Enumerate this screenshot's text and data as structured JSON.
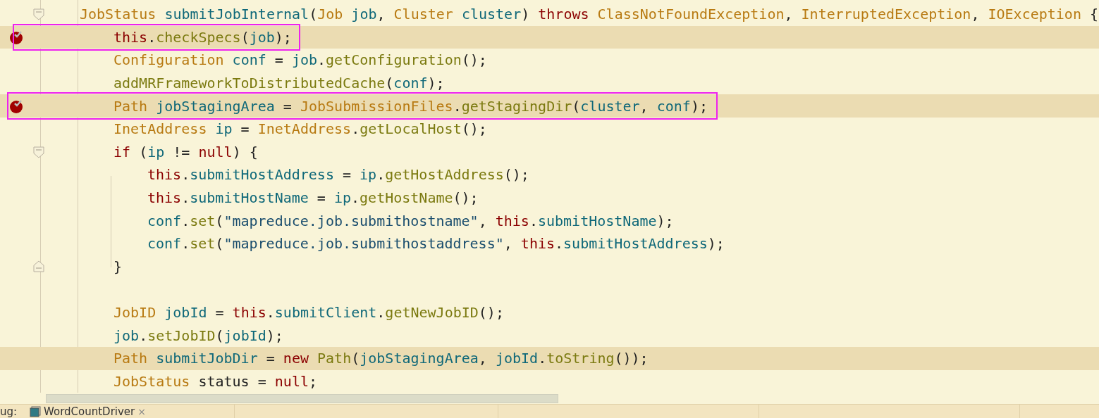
{
  "lines": [
    {
      "kind": "code",
      "fold_open": true,
      "fold_close": false,
      "breakpoint": false,
      "highlighted": false,
      "annotated": false,
      "tokens": [
        {
          "text": "JobStatus",
          "kind": "type"
        },
        {
          "text": " submitJobInternal",
          "kind": "field"
        },
        {
          "text": "(",
          "kind": "plain"
        },
        {
          "text": "Job",
          "kind": "type"
        },
        {
          "text": " job",
          "kind": "field"
        },
        {
          "text": ", ",
          "kind": "plain"
        },
        {
          "text": "Cluster",
          "kind": "type"
        },
        {
          "text": " cluster",
          "kind": "field"
        },
        {
          "text": ") ",
          "kind": "plain"
        },
        {
          "text": "throws",
          "kind": "keyword"
        },
        {
          "text": " ClassNotFoundException",
          "kind": "type"
        },
        {
          "text": ", ",
          "kind": "plain"
        },
        {
          "text": "InterruptedException",
          "kind": "type"
        },
        {
          "text": ", ",
          "kind": "plain"
        },
        {
          "text": "IOException",
          "kind": "type"
        },
        {
          "text": " {",
          "kind": "plain"
        }
      ],
      "children": [
        {
          "kind": "code",
          "fold_open": false,
          "fold_close": false,
          "breakpoint": true,
          "highlighted": true,
          "annotated": true,
          "tokens": [
            {
              "text": "this",
              "kind": "keyword"
            },
            {
              "text": ".",
              "kind": "plain"
            },
            {
              "text": "checkSpecs",
              "kind": "method"
            },
            {
              "text": "(",
              "kind": "plain"
            },
            {
              "text": "job",
              "kind": "field"
            },
            {
              "text": ");",
              "kind": "plain"
            }
          ]
        },
        {
          "kind": "code",
          "fold_open": false,
          "fold_close": false,
          "breakpoint": false,
          "highlighted": false,
          "annotated": false,
          "tokens": [
            {
              "text": "Configuration",
              "kind": "type"
            },
            {
              "text": " conf",
              "kind": "field"
            },
            {
              "text": " = ",
              "kind": "plain"
            },
            {
              "text": "job",
              "kind": "field"
            },
            {
              "text": ".",
              "kind": "plain"
            },
            {
              "text": "getConfiguration",
              "kind": "method"
            },
            {
              "text": "();",
              "kind": "plain"
            }
          ]
        },
        {
          "kind": "code",
          "fold_open": false,
          "fold_close": false,
          "breakpoint": false,
          "highlighted": false,
          "annotated": false,
          "tokens": [
            {
              "text": "addMRFrameworkToDistributedCache",
              "kind": "method"
            },
            {
              "text": "(",
              "kind": "plain"
            },
            {
              "text": "conf",
              "kind": "field"
            },
            {
              "text": ");",
              "kind": "plain"
            }
          ]
        },
        {
          "kind": "code",
          "fold_open": false,
          "fold_close": false,
          "breakpoint": true,
          "highlighted": true,
          "annotated": true,
          "tokens": [
            {
              "text": "Path",
              "kind": "type"
            },
            {
              "text": " jobStagingArea",
              "kind": "field"
            },
            {
              "text": " = ",
              "kind": "plain"
            },
            {
              "text": "JobSubmissionFiles",
              "kind": "type"
            },
            {
              "text": ".",
              "kind": "plain"
            },
            {
              "text": "getStagingDir",
              "kind": "method"
            },
            {
              "text": "(",
              "kind": "plain"
            },
            {
              "text": "cluster",
              "kind": "field"
            },
            {
              "text": ", ",
              "kind": "plain"
            },
            {
              "text": "conf",
              "kind": "field"
            },
            {
              "text": ");",
              "kind": "plain"
            }
          ]
        },
        {
          "kind": "code",
          "fold_open": false,
          "fold_close": false,
          "breakpoint": false,
          "highlighted": false,
          "annotated": false,
          "tokens": [
            {
              "text": "InetAddress",
              "kind": "type"
            },
            {
              "text": " ip",
              "kind": "field"
            },
            {
              "text": " = ",
              "kind": "plain"
            },
            {
              "text": "InetAddress",
              "kind": "type"
            },
            {
              "text": ".",
              "kind": "plain"
            },
            {
              "text": "getLocalHost",
              "kind": "method"
            },
            {
              "text": "();",
              "kind": "plain"
            }
          ]
        },
        {
          "kind": "code",
          "fold_open": true,
          "fold_close": false,
          "breakpoint": false,
          "highlighted": false,
          "annotated": false,
          "tokens": [
            {
              "text": "if",
              "kind": "keyword"
            },
            {
              "text": " (",
              "kind": "plain"
            },
            {
              "text": "ip",
              "kind": "field"
            },
            {
              "text": " != ",
              "kind": "plain"
            },
            {
              "text": "null",
              "kind": "keyword"
            },
            {
              "text": ") {",
              "kind": "plain"
            }
          ],
          "children": [
            {
              "kind": "code",
              "fold_open": false,
              "fold_close": false,
              "breakpoint": false,
              "highlighted": false,
              "annotated": false,
              "tokens": [
                {
                  "text": "this",
                  "kind": "keyword"
                },
                {
                  "text": ".",
                  "kind": "plain"
                },
                {
                  "text": "submitHostAddress",
                  "kind": "field"
                },
                {
                  "text": " = ",
                  "kind": "plain"
                },
                {
                  "text": "ip",
                  "kind": "field"
                },
                {
                  "text": ".",
                  "kind": "plain"
                },
                {
                  "text": "getHostAddress",
                  "kind": "method"
                },
                {
                  "text": "();",
                  "kind": "plain"
                }
              ]
            },
            {
              "kind": "code",
              "fold_open": false,
              "fold_close": false,
              "breakpoint": false,
              "highlighted": false,
              "annotated": false,
              "tokens": [
                {
                  "text": "this",
                  "kind": "keyword"
                },
                {
                  "text": ".",
                  "kind": "plain"
                },
                {
                  "text": "submitHostName",
                  "kind": "field"
                },
                {
                  "text": " = ",
                  "kind": "plain"
                },
                {
                  "text": "ip",
                  "kind": "field"
                },
                {
                  "text": ".",
                  "kind": "plain"
                },
                {
                  "text": "getHostName",
                  "kind": "method"
                },
                {
                  "text": "();",
                  "kind": "plain"
                }
              ]
            },
            {
              "kind": "code",
              "fold_open": false,
              "fold_close": false,
              "breakpoint": false,
              "highlighted": false,
              "annotated": false,
              "tokens": [
                {
                  "text": "conf",
                  "kind": "field"
                },
                {
                  "text": ".",
                  "kind": "plain"
                },
                {
                  "text": "set",
                  "kind": "method"
                },
                {
                  "text": "(",
                  "kind": "plain"
                },
                {
                  "text": "\"mapreduce.job.submithostname\"",
                  "kind": "string"
                },
                {
                  "text": ", ",
                  "kind": "plain"
                },
                {
                  "text": "this",
                  "kind": "keyword"
                },
                {
                  "text": ".",
                  "kind": "plain"
                },
                {
                  "text": "submitHostName",
                  "kind": "field"
                },
                {
                  "text": ");",
                  "kind": "plain"
                }
              ]
            },
            {
              "kind": "code",
              "fold_open": false,
              "fold_close": false,
              "breakpoint": false,
              "highlighted": false,
              "annotated": false,
              "tokens": [
                {
                  "text": "conf",
                  "kind": "field"
                },
                {
                  "text": ".",
                  "kind": "plain"
                },
                {
                  "text": "set",
                  "kind": "method"
                },
                {
                  "text": "(",
                  "kind": "plain"
                },
                {
                  "text": "\"mapreduce.job.submithostaddress\"",
                  "kind": "string"
                },
                {
                  "text": ", ",
                  "kind": "plain"
                },
                {
                  "text": "this",
                  "kind": "keyword"
                },
                {
                  "text": ".",
                  "kind": "plain"
                },
                {
                  "text": "submitHostAddress",
                  "kind": "field"
                },
                {
                  "text": ");",
                  "kind": "plain"
                }
              ]
            }
          ]
        },
        {
          "kind": "code",
          "fold_open": false,
          "fold_close": true,
          "breakpoint": false,
          "highlighted": false,
          "annotated": false,
          "tokens": [
            {
              "text": "}",
              "kind": "plain"
            }
          ]
        },
        {
          "kind": "blank"
        },
        {
          "kind": "code",
          "fold_open": false,
          "fold_close": false,
          "breakpoint": false,
          "highlighted": false,
          "annotated": false,
          "tokens": [
            {
              "text": "JobID",
              "kind": "type"
            },
            {
              "text": " jobId",
              "kind": "field"
            },
            {
              "text": " = ",
              "kind": "plain"
            },
            {
              "text": "this",
              "kind": "keyword"
            },
            {
              "text": ".",
              "kind": "plain"
            },
            {
              "text": "submitClient",
              "kind": "field"
            },
            {
              "text": ".",
              "kind": "plain"
            },
            {
              "text": "getNewJobID",
              "kind": "method"
            },
            {
              "text": "();",
              "kind": "plain"
            }
          ]
        },
        {
          "kind": "code",
          "fold_open": false,
          "fold_close": false,
          "breakpoint": false,
          "highlighted": false,
          "annotated": false,
          "tokens": [
            {
              "text": "job",
              "kind": "field"
            },
            {
              "text": ".",
              "kind": "plain"
            },
            {
              "text": "setJobID",
              "kind": "method"
            },
            {
              "text": "(",
              "kind": "plain"
            },
            {
              "text": "jobId",
              "kind": "field"
            },
            {
              "text": ");",
              "kind": "plain"
            }
          ]
        },
        {
          "kind": "code",
          "fold_open": false,
          "fold_close": false,
          "breakpoint": false,
          "highlighted": true,
          "annotated": false,
          "tokens": [
            {
              "text": "Path",
              "kind": "type"
            },
            {
              "text": " submitJobDir",
              "kind": "field"
            },
            {
              "text": " = ",
              "kind": "plain"
            },
            {
              "text": "new",
              "kind": "keyword"
            },
            {
              "text": " Path",
              "kind": "method"
            },
            {
              "text": "(",
              "kind": "plain"
            },
            {
              "text": "jobStagingArea",
              "kind": "field"
            },
            {
              "text": ", ",
              "kind": "plain"
            },
            {
              "text": "jobId",
              "kind": "field"
            },
            {
              "text": ".",
              "kind": "plain"
            },
            {
              "text": "toString",
              "kind": "method"
            },
            {
              "text": "());",
              "kind": "plain"
            }
          ]
        },
        {
          "kind": "code",
          "fold_open": false,
          "fold_close": false,
          "breakpoint": false,
          "highlighted": false,
          "annotated": false,
          "tokens": [
            {
              "text": "JobStatus",
              "kind": "type"
            },
            {
              "text": " status = ",
              "kind": "plain"
            },
            {
              "text": "null",
              "kind": "keyword"
            },
            {
              "text": ";",
              "kind": "plain"
            }
          ]
        }
      ]
    }
  ],
  "bottom_bar": {
    "label": "ug:",
    "tabs": [
      {
        "title": "WordCountDriver",
        "close": "×"
      }
    ]
  }
}
